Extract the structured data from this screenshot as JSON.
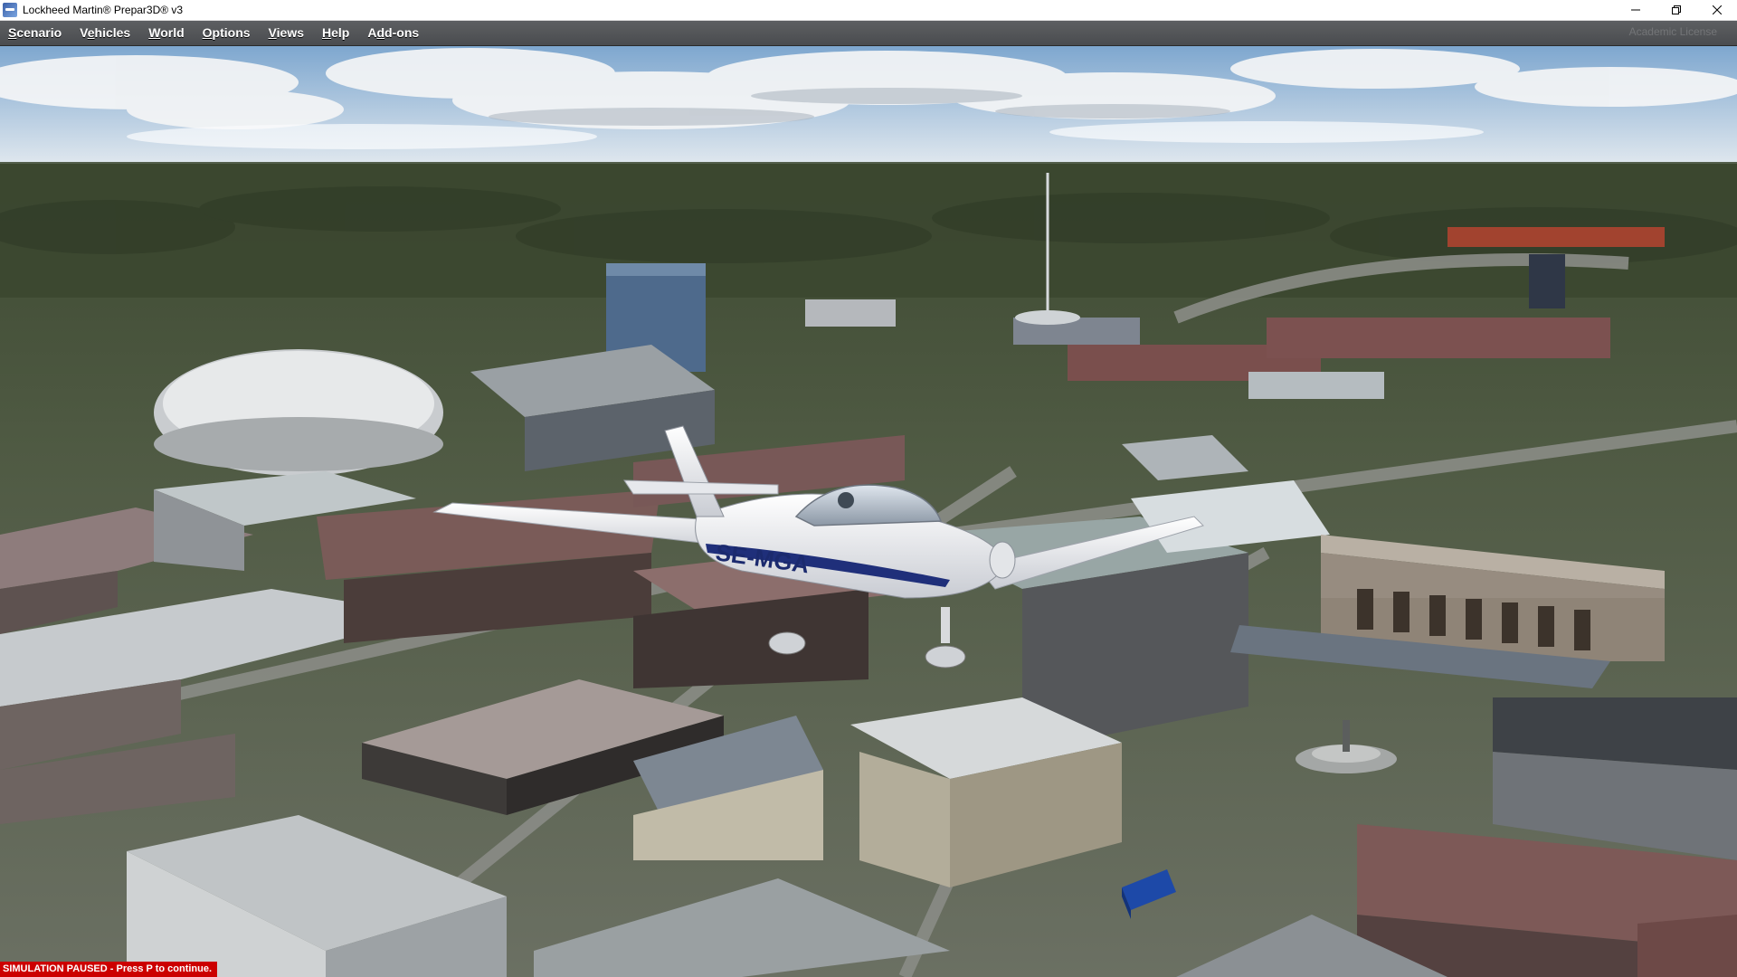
{
  "window": {
    "title": "Lockheed Martin® Prepar3D® v3",
    "controls": {
      "minimize": "—",
      "restore": "❐",
      "close": "✕"
    }
  },
  "menubar": {
    "items": [
      {
        "id": "scenario",
        "prefix": "",
        "underline": "S",
        "rest": "cenario"
      },
      {
        "id": "vehicles",
        "prefix": "V",
        "underline": "e",
        "rest": "hicles"
      },
      {
        "id": "world",
        "prefix": "",
        "underline": "W",
        "rest": "orld"
      },
      {
        "id": "options",
        "prefix": "",
        "underline": "O",
        "rest": "ptions"
      },
      {
        "id": "views",
        "prefix": "",
        "underline": "V",
        "rest": "iews"
      },
      {
        "id": "help",
        "prefix": "",
        "underline": "H",
        "rest": "elp"
      },
      {
        "id": "addons",
        "prefix": "A",
        "underline": "d",
        "rest": "d-ons"
      }
    ],
    "watermark": "Academic License"
  },
  "viewport": {
    "aircraft_registration": "SE-MGA",
    "colors": {
      "sky_top": "#7ea7cf",
      "sky_horizon": "#dfe7ee",
      "forest": "#3d4a30",
      "ground": "#5f6a55",
      "road": "#7b7e78",
      "aircraft_body": "#f2f3f6",
      "aircraft_stripe": "#1f2f7a"
    }
  },
  "status": {
    "message": "SIMULATION PAUSED - Press P to continue."
  }
}
